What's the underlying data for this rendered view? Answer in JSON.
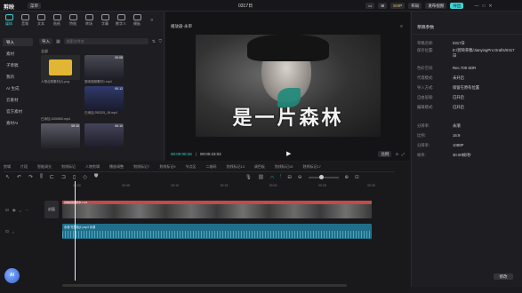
{
  "app": {
    "logo": "剪映",
    "menu_label": "菜单",
    "project_title": "0317日",
    "vip_label": "SVIP",
    "layout_label": "布局",
    "publish_label": "发布视频",
    "export_label": "导出"
  },
  "toolbar_tabs": [
    {
      "label": "媒体",
      "icon": "media-icon"
    },
    {
      "label": "音频",
      "icon": "audio-icon"
    },
    {
      "label": "文本",
      "icon": "text-icon"
    },
    {
      "label": "贴纸",
      "icon": "sticker-icon"
    },
    {
      "label": "特效",
      "icon": "effect-icon"
    },
    {
      "label": "转场",
      "icon": "transition-icon"
    },
    {
      "label": "字幕",
      "icon": "caption-icon"
    },
    {
      "label": "数字人",
      "icon": "avatar-icon"
    },
    {
      "label": "模板",
      "icon": "template-icon"
    }
  ],
  "media_sidebar": [
    {
      "label": "导入",
      "active": true
    },
    {
      "label": "素材",
      "active": false
    },
    {
      "label": "子草稿",
      "active": false
    },
    {
      "label": "我的",
      "active": false
    },
    {
      "label": "AI 生成",
      "active": false
    },
    {
      "label": "云素材",
      "active": false
    },
    {
      "label": "官方素材",
      "active": false
    },
    {
      "label": "素材AI",
      "active": false
    }
  ],
  "media_panel": {
    "import_button": "导入",
    "search_placeholder": "搜索文件名",
    "sort_label": "全部",
    "items": [
      {
        "label": "人物合照素材(2).png",
        "duration": "",
        "kind": "folder"
      },
      {
        "label": "剪映视频素材1.mp4",
        "duration": "00:08",
        "kind": "video"
      },
      {
        "label": "",
        "duration": "",
        "kind": "empty"
      },
      {
        "label": "已添加 250325_18.mp4",
        "duration": "00:12",
        "kind": "video"
      },
      {
        "label": "已添加 1000850.mp4",
        "duration": "00:06",
        "kind": "video"
      },
      {
        "label": "",
        "duration": "00:10",
        "kind": "video"
      },
      {
        "label": "",
        "duration": "00:10",
        "kind": "video"
      }
    ]
  },
  "player": {
    "title": "播放器·永审",
    "overlay_text": "是一片森林",
    "time_current": "00:00:00:26",
    "time_total": "00:00:23:02",
    "ratio_label": "比例",
    "fullscreen_label": "全屏"
  },
  "properties": {
    "section_title": "草稿参数",
    "rows": [
      {
        "label": "草稿名称:",
        "value": "0317日"
      },
      {
        "label": "保存位置:",
        "value": "E:/剪映草稿/JianyingPro Drafts/0317日"
      },
      {
        "label": "色彩空间:",
        "value": "Rec.709 SDR"
      },
      {
        "label": "导入方式:",
        "value": "保留在原有位置"
      },
      {
        "label": "代理模式:",
        "value": "未开启"
      },
      {
        "label": "自由层级:",
        "value": "已开启"
      },
      {
        "label": "编辑模式:",
        "value": "已开启"
      },
      {
        "label": "分辨率:",
        "value": "永潮"
      },
      {
        "label": "比例:",
        "value": "16:9"
      },
      {
        "label": "分辨率:",
        "value": "1080P"
      },
      {
        "label": "帧率:",
        "value": "30.00帧/秒"
      }
    ],
    "modify_button": "修改"
  },
  "timeline": {
    "tabs": [
      "剪辑",
      "片段",
      "智能调光",
      "划线标记",
      "人物剪辑",
      "播放调整",
      "划线标记7",
      "划线标记9",
      "节点区",
      "二维码",
      "划线标记13",
      "调色板",
      "划线标记15",
      "划线标记17"
    ],
    "ruler": [
      "00:00",
      "00:05",
      "00:10",
      "00:15",
      "00:20",
      "00:25",
      "00:30"
    ],
    "clip_label": "剪映视频素材1.mp4",
    "cover_label": "封面",
    "audio_label": "永潮  完整版(1).mp3  永潮",
    "zoom_label": "缩放"
  },
  "avatar_badge": "AI",
  "colors": {
    "accent": "#3fd0d0",
    "audio_track": "#1f6f8b",
    "video_track": "#2c3a3a"
  }
}
